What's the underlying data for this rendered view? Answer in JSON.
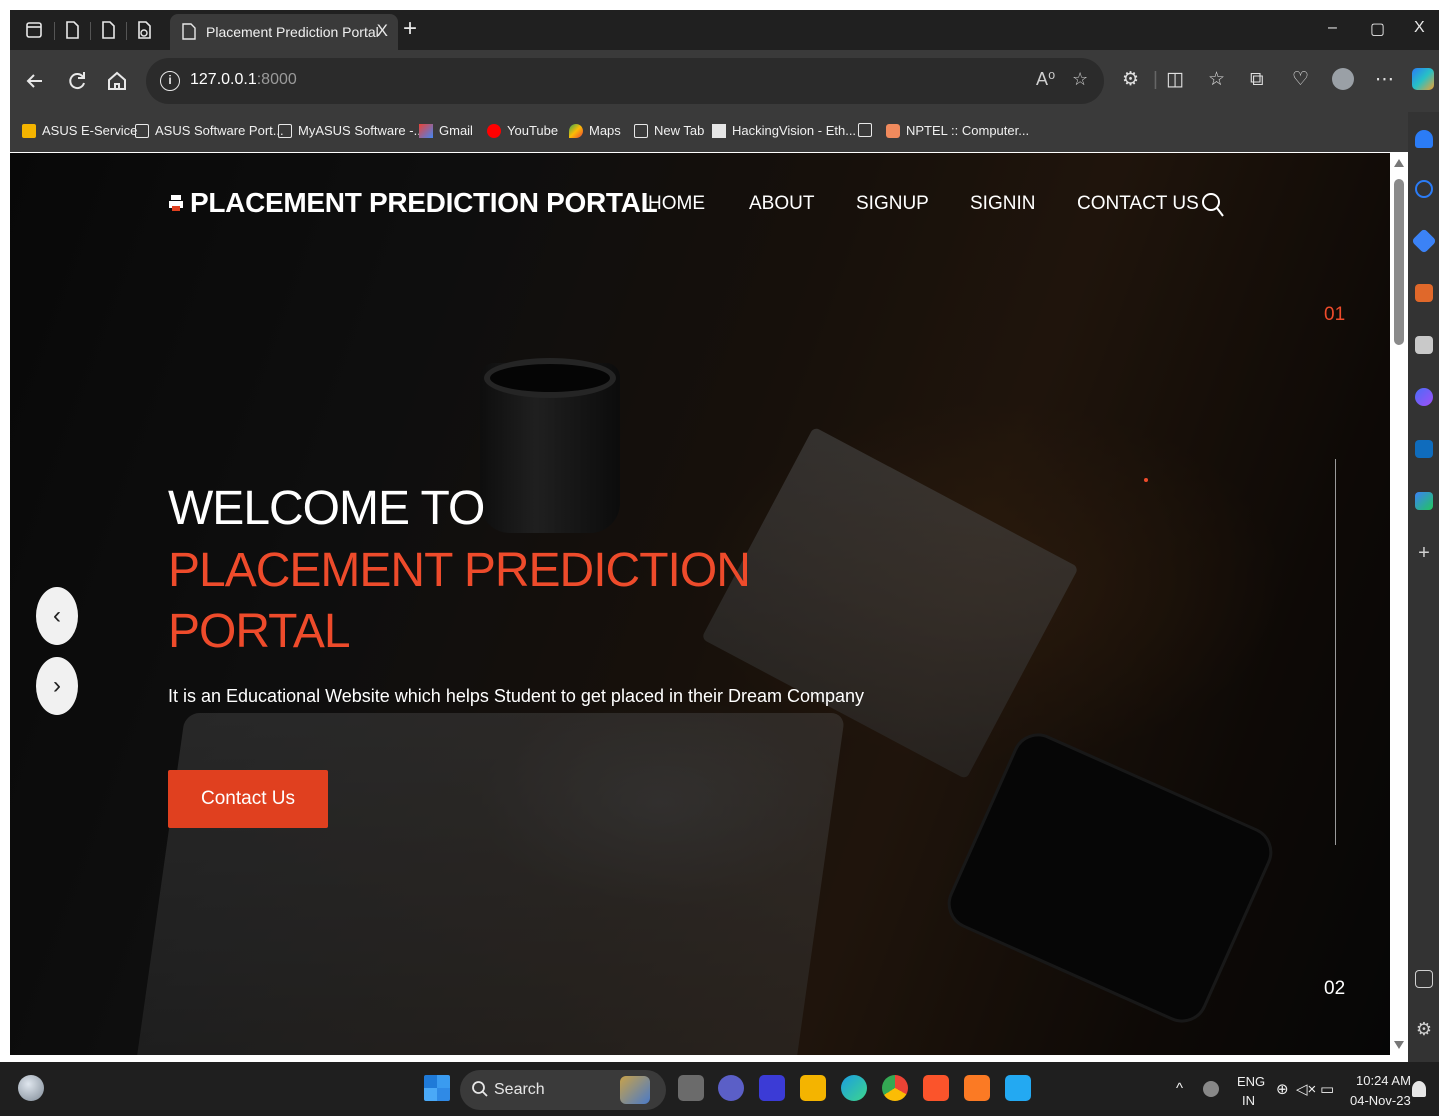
{
  "browser": {
    "tab_title": "Placement Prediction Portal",
    "tab_close": "X",
    "new_tab": "+",
    "controls": {
      "minimize": "–",
      "maximize": "▢",
      "close": "X"
    },
    "url_host": "127.0.0.1",
    "url_port": ":8000",
    "read_aloud": "A⁰",
    "bookmarks": [
      {
        "label": "ASUS E-Service",
        "icon": "folder-icon"
      },
      {
        "label": "ASUS Software Port...",
        "icon": "page-icon"
      },
      {
        "label": "MyASUS Software -...",
        "icon": "page-icon"
      },
      {
        "label": "Gmail",
        "icon": "gmail-icon"
      },
      {
        "label": "YouTube",
        "icon": "youtube-icon"
      },
      {
        "label": "Maps",
        "icon": "maps-icon"
      },
      {
        "label": "New Tab",
        "icon": "page-icon"
      },
      {
        "label": "HackingVision - Eth...",
        "icon": "site-icon"
      },
      {
        "label": "",
        "icon": "page-icon"
      },
      {
        "label": "NPTEL :: Computer...",
        "icon": "nptel-icon"
      }
    ]
  },
  "site": {
    "logo_text": "PLACEMENT PREDICTION PORTAL",
    "nav": [
      {
        "label": "HOME"
      },
      {
        "label": "ABOUT"
      },
      {
        "label": "SIGNUP"
      },
      {
        "label": "SIGNIN"
      },
      {
        "label": "CONTACT US"
      }
    ],
    "hero": {
      "line1": "WELCOME TO",
      "line2": "PLACEMENT PREDICTION",
      "line3": "PORTAL",
      "subtitle": "It is an Educational Website which helps Student to get placed in their Dream Company",
      "button": "Contact Us"
    },
    "slider": {
      "prev": "‹",
      "next": "›",
      "current": "01",
      "next_number": "02"
    },
    "colors": {
      "accent": "#ee4b2b",
      "button": "#e0401f"
    }
  },
  "taskbar": {
    "search_label": "Search",
    "lang": "ENG",
    "region": "IN",
    "time": "10:24 AM",
    "date": "04-Nov-23",
    "chevron": "^"
  }
}
